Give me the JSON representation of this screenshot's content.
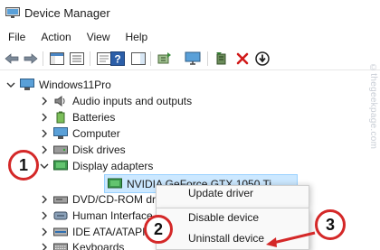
{
  "window": {
    "title": "Device Manager"
  },
  "menu": [
    "File",
    "Action",
    "View",
    "Help"
  ],
  "toolbar": {
    "icons": [
      "back-arrow-icon",
      "forward-arrow-icon",
      "show-hide-console-tree-icon",
      "properties-list-icon",
      "help-icon",
      "action-pane-icon",
      "scan-hardware-icon",
      "update-driver-icon",
      "uninstall-device-icon",
      "disable-device-icon"
    ]
  },
  "tree": {
    "root": "Windows11Pro",
    "items": [
      "Audio inputs and outputs",
      "Batteries",
      "Computer",
      "Disk drives",
      "Display adapters",
      "NVIDIA GeForce GTX 1050 Ti",
      "DVD/CD-ROM drives",
      "Human Interface Devices",
      "IDE ATA/ATAPI controllers",
      "Keyboards"
    ]
  },
  "context_menu": {
    "items": [
      "Update driver",
      "Disable device",
      "Uninstall device"
    ]
  },
  "steps": [
    "1",
    "2",
    "3"
  ],
  "watermark": "©thegeekpage.com",
  "colors": {
    "callout": "#d42828",
    "selection": "#cce8ff"
  }
}
